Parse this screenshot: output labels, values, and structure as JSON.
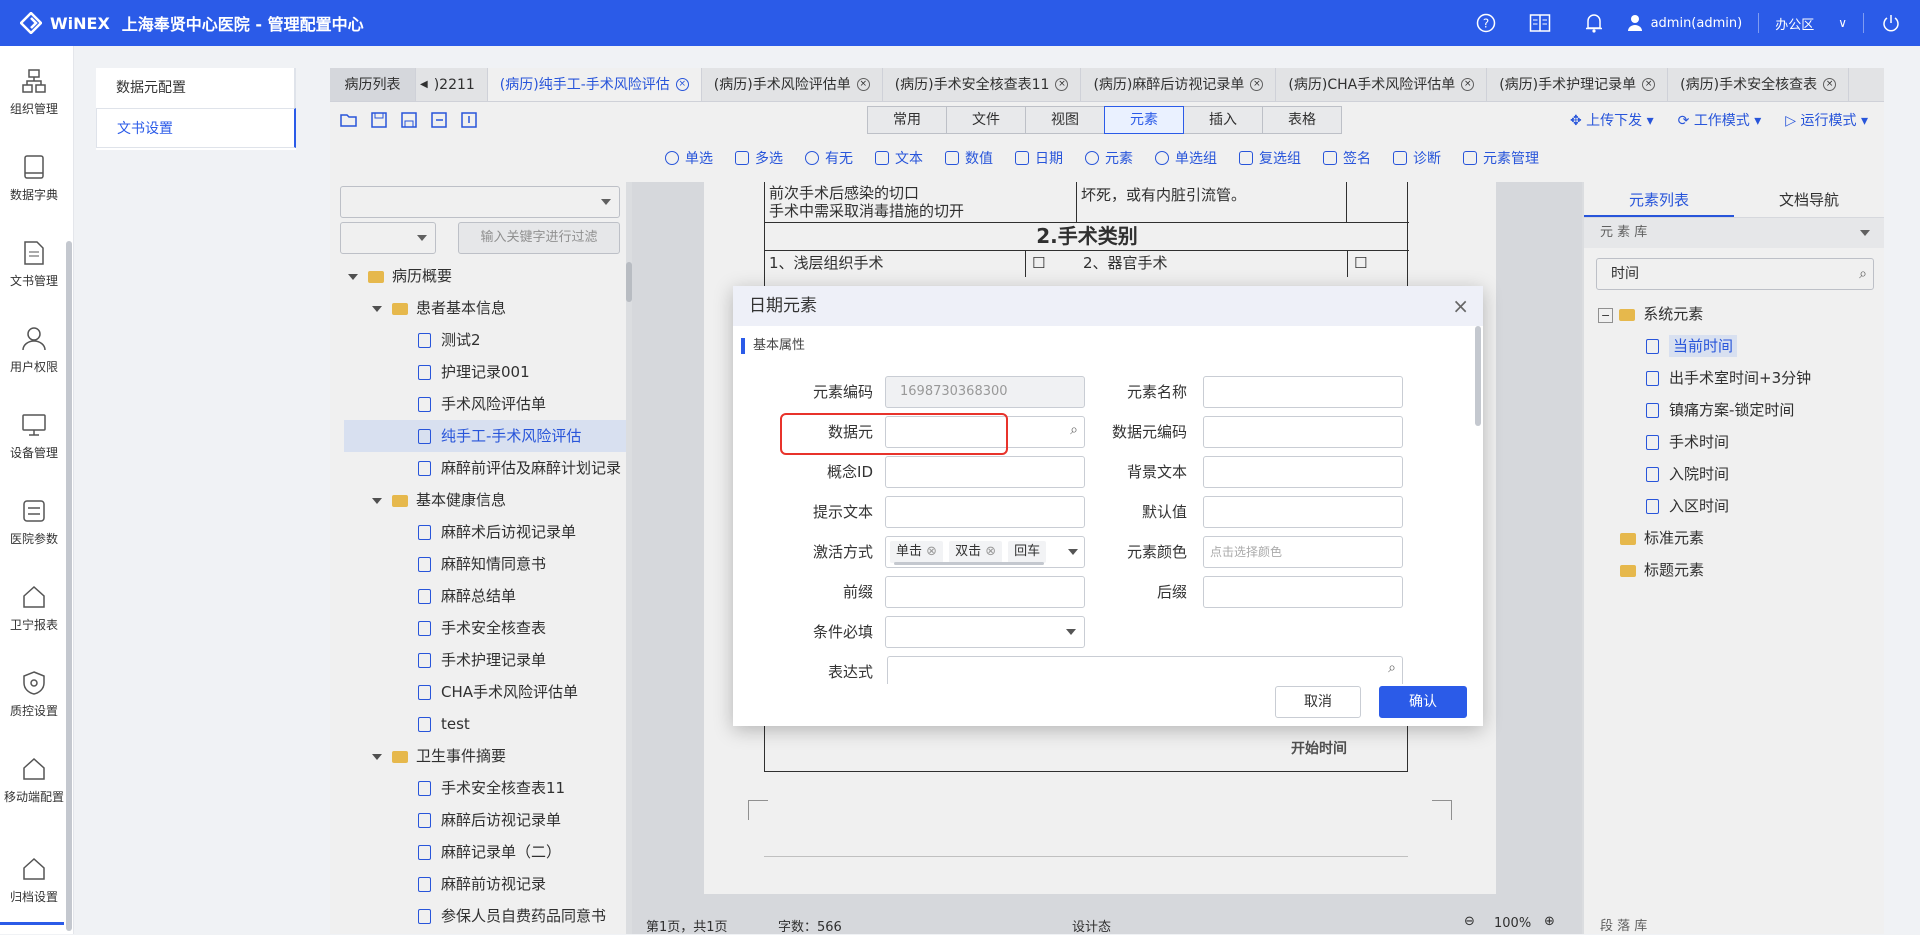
{
  "header": {
    "brand": "WiNEX",
    "title": "上海奉贤中心医院 - 管理配置中心",
    "user": "admin(admin)",
    "office": "办公区"
  },
  "leftnav": [
    {
      "label": "组织管理",
      "icon": "org-icon"
    },
    {
      "label": "数据字典",
      "icon": "book-icon"
    },
    {
      "label": "文书管理",
      "icon": "document-icon"
    },
    {
      "label": "用户权限",
      "icon": "user-icon"
    },
    {
      "label": "设备管理",
      "icon": "monitor-icon"
    },
    {
      "label": "医院参数",
      "icon": "settings-icon"
    },
    {
      "label": "卫宁报表",
      "icon": "report-icon"
    },
    {
      "label": "质控设置",
      "icon": "shield-icon"
    },
    {
      "label": "移动端配置",
      "icon": "mobile-icon"
    },
    {
      "label": "归档设置",
      "icon": "archive-icon"
    }
  ],
  "subnav": {
    "item1": "数据元配置",
    "item2": "文书设置"
  },
  "tabs": [
    {
      "label": "病历列表"
    },
    {
      "label": ")2211"
    },
    {
      "label": "(病历)纯手工-手术风险评估"
    },
    {
      "label": "(病历)手术风险评估单"
    },
    {
      "label": "(病历)手术安全核查表11"
    },
    {
      "label": "(病历)麻醉后访视记录单"
    },
    {
      "label": "(病历)CHA手术风险评估单"
    },
    {
      "label": "(病历)手术护理记录单"
    },
    {
      "label": "(病历)手术安全核查表"
    }
  ],
  "ribbon": [
    "常用",
    "文件",
    "视图",
    "元素",
    "插入",
    "表格"
  ],
  "right_tools": [
    "上传下发",
    "工作模式",
    "运行模式"
  ],
  "elements": [
    "单选",
    "多选",
    "有无",
    "文本",
    "数值",
    "日期",
    "元素",
    "单选组",
    "复选组",
    "签名",
    "诊断",
    "元素管理"
  ],
  "tree": {
    "filter_placeholder": "输入关键字进行过滤",
    "nodes": [
      "病历概要",
      "患者基本信息",
      "测试2",
      "护理记录001",
      "手术风险评估单",
      "纯手工-手术风险评估",
      "麻醉前评估及麻醉计划记录",
      "基本健康信息",
      "麻醉术后访视记录单",
      "麻醉知情同意书",
      "麻醉总结单",
      "手术安全核查表",
      "手术护理记录单",
      "CHA手术风险评估单",
      "test",
      "卫生事件摘要",
      "手术安全核查表11",
      "麻醉后访视记录单",
      "麻醉记录单（二）",
      "麻醉前访视记录",
      "参保人员自费药品同意书"
    ]
  },
  "paper": {
    "line1": "前次手术后感染的切口",
    "line2": "坏死，或有内脏引流管。",
    "line3": "手术中需采取消毒措施的切开",
    "heading": "2.手术类别",
    "cell1": "1、浅层组织手术",
    "cell2": "2、器官手术",
    "footer_text": "开始时间"
  },
  "status": {
    "page": "第1页，共1页",
    "words": "字数：566",
    "mode": "设计态",
    "zoom": "100%"
  },
  "right": {
    "tab1": "元素列表",
    "tab2": "文档导航",
    "lib": "元 素 库",
    "search": "时间",
    "bottom": "段 落 库",
    "nodes": [
      "系统元素",
      "当前时间",
      "出手术室时间+3分钟",
      "镇痛方案-锁定时间",
      "手术时间",
      "入院时间",
      "入区时间",
      "标准元素",
      "标题元素"
    ]
  },
  "modal": {
    "title": "日期元素",
    "section": "基本属性",
    "code_label": "元素编码",
    "code_value": "1698730368300",
    "name_label": "元素名称",
    "dataelem_label": "数据元",
    "dataelem_code_label": "数据元编码",
    "concept_label": "概念ID",
    "bg_label": "背景文本",
    "hint_label": "提示文本",
    "default_label": "默认值",
    "activate_label": "激活方式",
    "chips": [
      "单击",
      "双击",
      "回车"
    ],
    "color_label": "元素颜色",
    "color_placeholder": "点击选择颜色",
    "prefix_label": "前缀",
    "suffix_label": "后缀",
    "required_label": "条件必填",
    "expr_label": "表达式",
    "cancel": "取消",
    "confirm": "确认"
  }
}
